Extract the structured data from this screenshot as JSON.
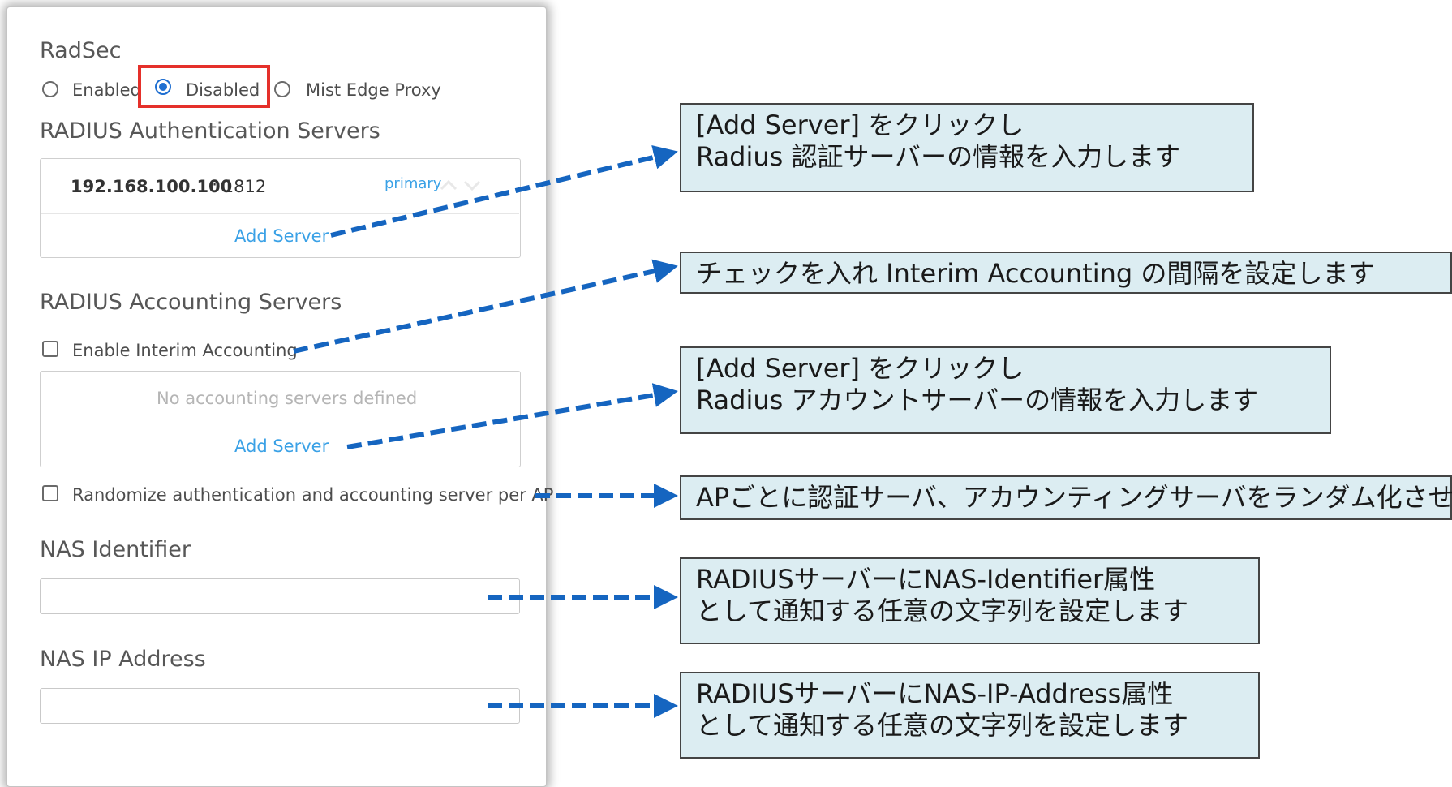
{
  "radsec": {
    "title": "RadSec",
    "options": [
      {
        "label": "Enabled",
        "selected": false
      },
      {
        "label": "Disabled",
        "selected": true
      },
      {
        "label": "Mist Edge Proxy",
        "selected": false
      }
    ]
  },
  "auth": {
    "title": "RADIUS Authentication Servers",
    "servers": [
      {
        "ip": "192.168.100.100",
        "port": " : 1812",
        "tag": "primary"
      }
    ],
    "add_label": "Add Server"
  },
  "acct": {
    "title": "RADIUS Accounting Servers",
    "interim_label": "Enable Interim Accounting",
    "empty_text": "No accounting servers defined",
    "add_label": "Add Server"
  },
  "randomize_label": "Randomize authentication and accounting server per AP",
  "nas_id": {
    "label": "NAS Identifier",
    "value": ""
  },
  "nas_ip": {
    "label": "NAS IP Address",
    "value": ""
  },
  "callouts": [
    {
      "lines": [
        "[Add Server] をクリックし",
        "Radius 認証サーバーの情報を入力します"
      ]
    },
    {
      "lines": [
        "チェックを入れ Interim Accounting の間隔を設定します"
      ]
    },
    {
      "lines": [
        "[Add Server] をクリックし",
        "Radius アカウントサーバーの情報を入力します"
      ]
    },
    {
      "lines": [
        "APごとに認証サーバ、アカウンティングサーバをランダム化させます"
      ]
    },
    {
      "lines": [
        "RADIUSサーバーにNAS-Identifier属性",
        "として通知する任意の文字列を設定します"
      ]
    },
    {
      "lines": [
        "RADIUSサーバーにNAS-IP-Address属性",
        "として通知する任意の文字列を設定します"
      ]
    }
  ],
  "colors": {
    "accent": "#1f6fd1",
    "link": "#3aa1e6",
    "highlight": "#e5302a",
    "callout_bg": "#dcedf2",
    "arrow": "#1565c0"
  }
}
